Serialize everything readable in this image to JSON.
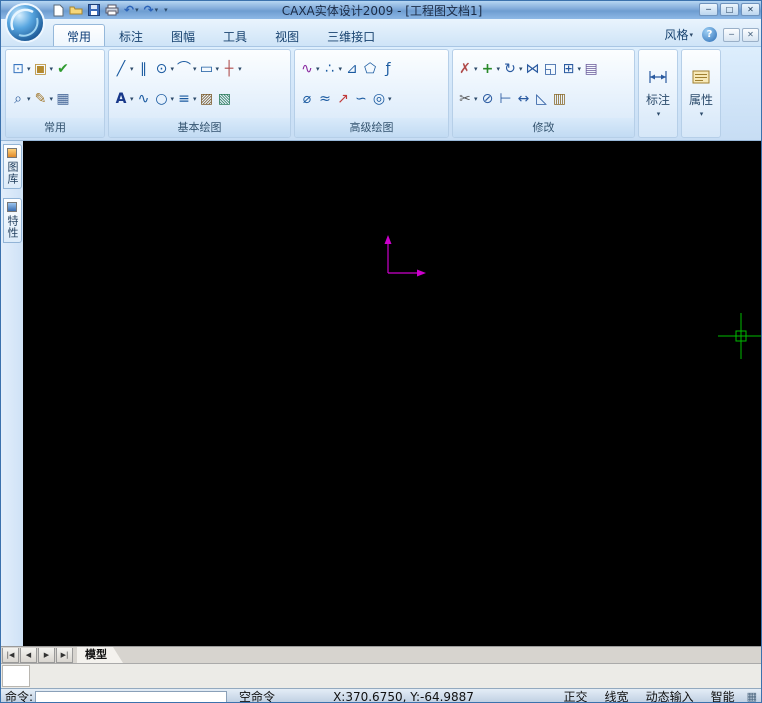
{
  "window": {
    "title": "CAXA实体设计2009 - [工程图文档1]",
    "controls": [
      {
        "name": "minimize-button",
        "glyph": "─"
      },
      {
        "name": "maximize-button",
        "glyph": "□"
      },
      {
        "name": "close-button",
        "glyph": "✕"
      }
    ]
  },
  "quick_access": [
    {
      "name": "new-document-icon"
    },
    {
      "name": "open-file-icon"
    },
    {
      "name": "save-icon"
    },
    {
      "name": "print-icon"
    },
    {
      "name": "undo-icon",
      "dropdown": true
    },
    {
      "name": "redo-icon",
      "dropdown": true
    },
    {
      "name": "toolbar-options-icon",
      "dropdown": true
    }
  ],
  "ribbon": {
    "tabs": [
      {
        "label": "常用",
        "active": true
      },
      {
        "label": "标注",
        "active": false
      },
      {
        "label": "图幅",
        "active": false
      },
      {
        "label": "工具",
        "active": false
      },
      {
        "label": "视图",
        "active": false
      },
      {
        "label": "三维接口",
        "active": false
      }
    ],
    "style_dropdown_label": "风格",
    "help_glyph": "?",
    "doc_controls": [
      {
        "name": "doc-minimize-button",
        "glyph": "─"
      },
      {
        "name": "doc-close-button",
        "glyph": "✕"
      }
    ],
    "groups": [
      {
        "label": "常用",
        "rows": [
          [
            {
              "name": "copy-icon",
              "dropdown": true
            },
            {
              "name": "paste-icon",
              "dropdown": true
            },
            {
              "name": "update-view-icon",
              "dropdown": false
            }
          ],
          [
            {
              "name": "zoom-icon",
              "dropdown": true
            },
            {
              "name": "sketch-edit-icon",
              "dropdown": true
            },
            {
              "name": "display-settings-icon",
              "dropdown": false
            }
          ]
        ]
      },
      {
        "label": "基本绘图",
        "rows": [
          [
            {
              "name": "line-icon",
              "dropdown": true
            },
            {
              "name": "parallel-line-icon",
              "dropdown": false
            },
            {
              "name": "circle-icon",
              "dropdown": true
            },
            {
              "name": "arc-icon",
              "dropdown": true
            },
            {
              "name": "rectangle-icon",
              "dropdown": true
            },
            {
              "name": "center-line-icon",
              "dropdown": true
            }
          ],
          [
            {
              "name": "text-icon",
              "dropdown": true
            },
            {
              "name": "spline-icon",
              "dropdown": false
            },
            {
              "name": "ellipse-icon",
              "dropdown": true
            },
            {
              "name": "offset-line-icon",
              "dropdown": true
            },
            {
              "name": "hatch-icon",
              "dropdown": false
            },
            {
              "name": "fill-icon",
              "dropdown": false
            }
          ]
        ]
      },
      {
        "label": "高级绘图",
        "rows": [
          [
            {
              "name": "curve-icon",
              "dropdown": true
            },
            {
              "name": "point-icon",
              "dropdown": true
            },
            {
              "name": "angle-line-icon",
              "dropdown": false
            },
            {
              "name": "polygon-icon",
              "dropdown": false
            },
            {
              "name": "formula-curve-icon",
              "dropdown": false
            }
          ],
          [
            {
              "name": "section-line-icon",
              "dropdown": false
            },
            {
              "name": "wave-line-icon",
              "dropdown": false
            },
            {
              "name": "arrow-icon",
              "dropdown": false
            },
            {
              "name": "cloud-line-icon",
              "dropdown": false
            },
            {
              "name": "detail-view-icon",
              "dropdown": true
            }
          ]
        ]
      },
      {
        "label": "修改",
        "rows": [
          [
            {
              "name": "delete-icon",
              "dropdown": true
            },
            {
              "name": "move-icon",
              "dropdown": true
            },
            {
              "name": "rotate-icon",
              "dropdown": true
            },
            {
              "name": "mirror-icon",
              "dropdown": false
            },
            {
              "name": "scale-icon",
              "dropdown": false
            },
            {
              "name": "array-icon",
              "dropdown": true
            },
            {
              "name": "stamp-icon",
              "dropdown": false
            }
          ],
          [
            {
              "name": "trim-icon",
              "dropdown": true
            },
            {
              "name": "break-icon",
              "dropdown": false
            },
            {
              "name": "extend-icon",
              "dropdown": false
            },
            {
              "name": "stretch-icon",
              "dropdown": false
            },
            {
              "name": "chamfer-icon",
              "dropdown": false
            },
            {
              "name": "properties-brush-icon",
              "dropdown": false
            }
          ]
        ]
      }
    ],
    "tall_buttons": [
      {
        "label": "标注",
        "icon": "dimension-icon"
      },
      {
        "label": "属性",
        "icon": "properties-icon"
      }
    ]
  },
  "sidebar": {
    "tabs": [
      {
        "label": "图库",
        "icon": "library-icon"
      },
      {
        "label": "特性",
        "icon": "properties-panel-icon"
      }
    ]
  },
  "canvas": {
    "background": "#000000",
    "axis_color": "#cc00cc",
    "crosshair_color": "#00bb00"
  },
  "sheet_bar": {
    "nav": [
      {
        "name": "first-sheet-button",
        "glyph": "|◀"
      },
      {
        "name": "prev-sheet-button",
        "glyph": "◀"
      },
      {
        "name": "next-sheet-button",
        "glyph": "▶"
      },
      {
        "name": "last-sheet-button",
        "glyph": "▶|"
      }
    ],
    "tabs": [
      {
        "label": "模型",
        "active": true
      }
    ]
  },
  "status_bar": {
    "command_label": "命令:",
    "command_input_value": "",
    "prompt": "空命令",
    "coordinates": "X:370.6750, Y:-64.9887",
    "toggles": [
      {
        "label": "正交"
      },
      {
        "label": "线宽"
      },
      {
        "label": "动态输入"
      },
      {
        "label": "智能"
      }
    ],
    "tray_icon": "grid-icon"
  }
}
